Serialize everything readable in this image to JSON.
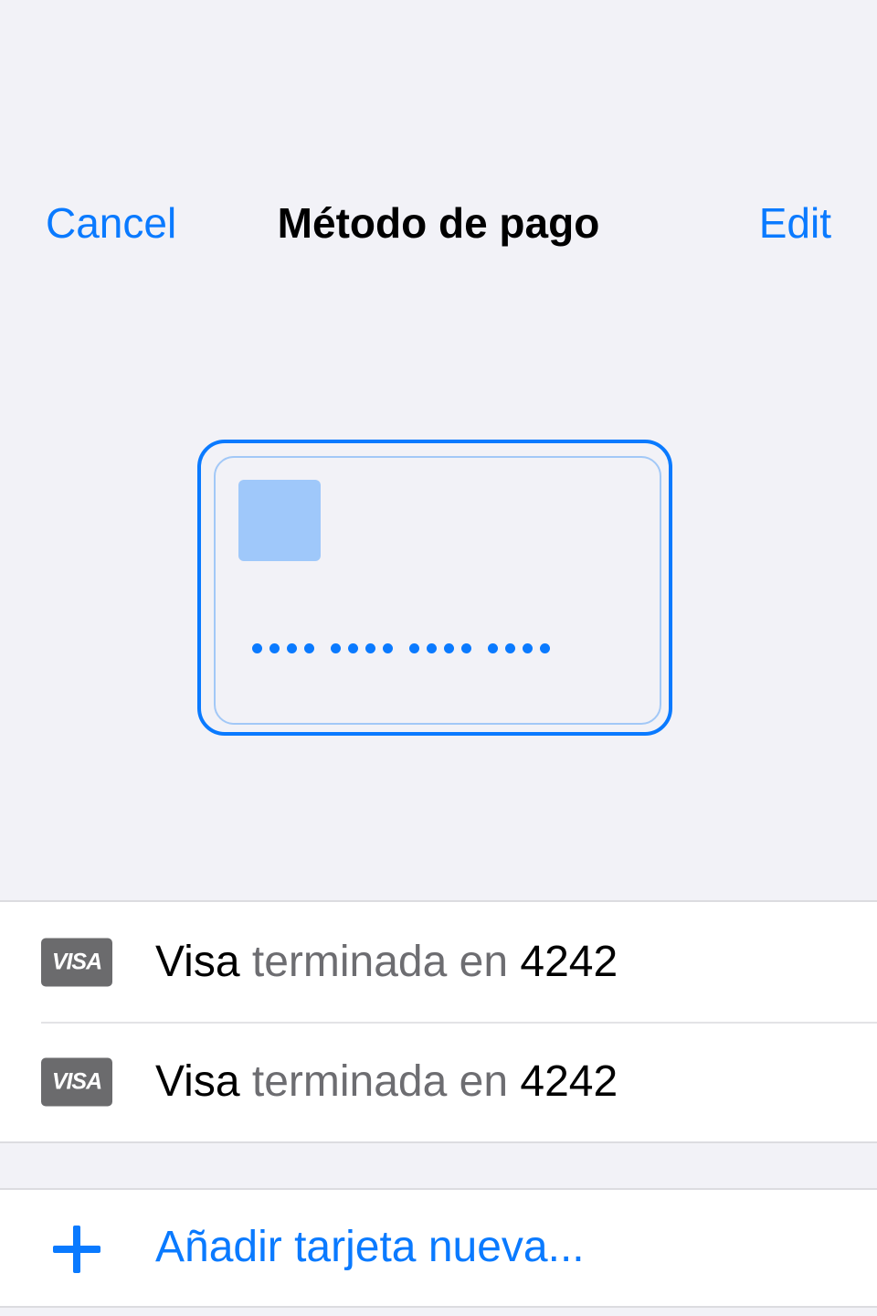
{
  "nav": {
    "cancel_label": "Cancel",
    "title": "Método de pago",
    "edit_label": "Edit"
  },
  "card_preview": {
    "masked_number": "•••• •••• •••• ••••"
  },
  "payment_methods": [
    {
      "brand_logo": "VISA",
      "brand": "Visa",
      "middle": "terminada en",
      "last4": "4242"
    },
    {
      "brand_logo": "VISA",
      "brand": "Visa",
      "middle": "terminada en",
      "last4": "4242"
    }
  ],
  "add_card": {
    "icon": "plus-icon",
    "label": "Añadir tarjeta nueva..."
  },
  "colors": {
    "accent": "#0a7aff",
    "background": "#f2f2f7",
    "muted_text": "#6d6d71",
    "visa_badge": "#6b6b6d"
  }
}
